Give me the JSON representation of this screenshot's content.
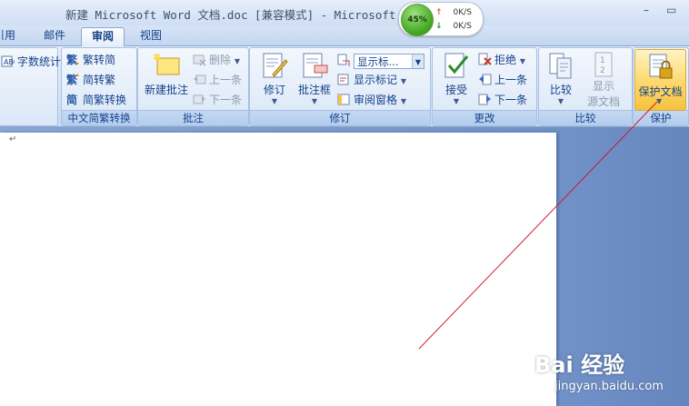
{
  "window": {
    "title": "新建 Microsoft Word 文档.doc [兼容模式] - Microsoft W",
    "minimize_glyph": "–",
    "maximize_glyph": "▭"
  },
  "net_monitor": {
    "percent": "45%",
    "upload": "0K/S",
    "download": "0K/S",
    "up_arrow": "↑",
    "down_arrow": "↓"
  },
  "tabs": [
    {
      "label": "引用",
      "active": false
    },
    {
      "label": "邮件",
      "active": false
    },
    {
      "label": "审阅",
      "active": true
    },
    {
      "label": "视图",
      "active": false
    }
  ],
  "ribbon": {
    "groups": {
      "proofing": {
        "word_count": "字数统计",
        "icon": "word-count-icon"
      },
      "chinese_conversion": {
        "label": "中文简繁转换",
        "to_traditional": "繁转简",
        "to_simplified": "简转繁",
        "convert": "简繁转换"
      },
      "comments": {
        "label": "批注",
        "new_comment": "新建批注",
        "delete": "删除",
        "previous": "上一条",
        "next": "下一条"
      },
      "tracking": {
        "label": "修订",
        "track_changes": "修订",
        "balloons": "批注框",
        "display_dropdown": "显示标...",
        "show_markup": "显示标记",
        "reviewing_pane": "审阅窗格"
      },
      "changes": {
        "label": "更改",
        "accept": "接受",
        "reject": "拒绝",
        "previous": "上一条",
        "next": "下一条"
      },
      "compare": {
        "label": "比较",
        "compare": "比较",
        "show_source_line1": "显示",
        "show_source_line2": "源文档"
      },
      "protect": {
        "label": "保护",
        "protect_document": "保护文档"
      }
    }
  },
  "document": {
    "paragraph_mark": "↵"
  },
  "annotation": {
    "color": "#d0192a"
  },
  "watermark": {
    "logo": "Bai 经验",
    "url": "jingyan.baidu.com"
  },
  "colors": {
    "ribbon_text": "#15428b",
    "protect_highlight": "#fdd86a",
    "doc_background": "#6f90c6"
  }
}
